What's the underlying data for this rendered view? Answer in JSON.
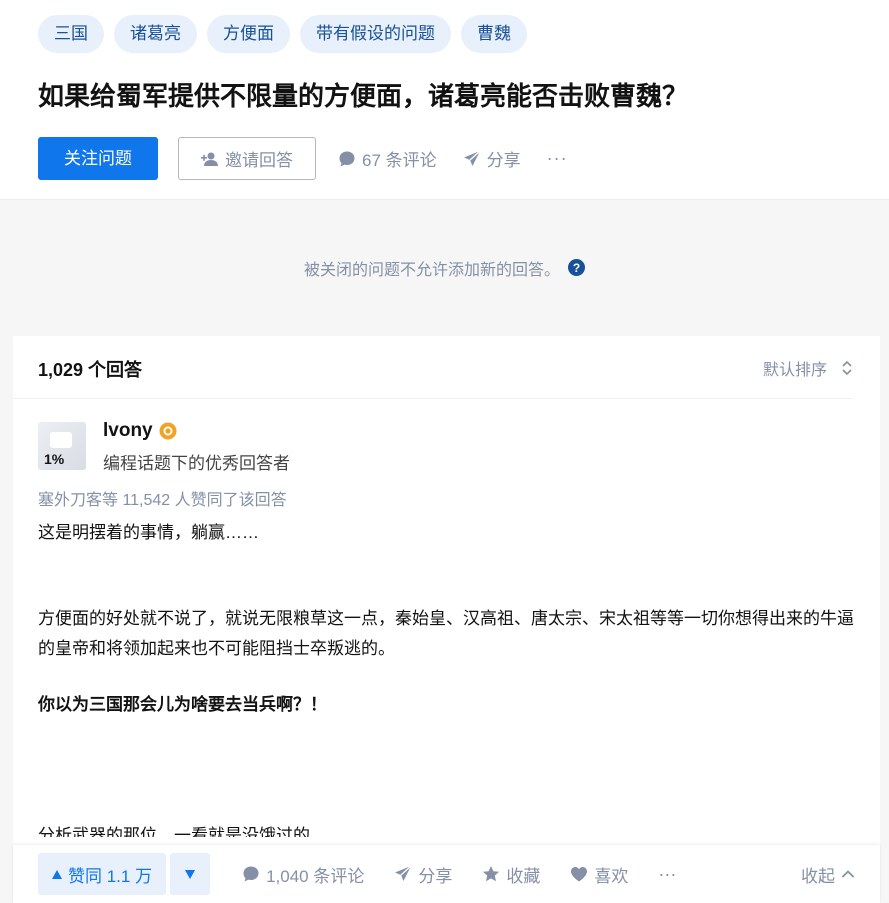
{
  "question": {
    "topics": [
      "三国",
      "诸葛亮",
      "方便面",
      "带有假设的问题",
      "曹魏"
    ],
    "title": "如果给蜀军提供不限量的方便面，诸葛亮能否击败曹魏？",
    "follow_label": "关注问题",
    "invite_label": "邀请回答",
    "comments_label": "67 条评论",
    "share_label": "分享",
    "more_label": "···"
  },
  "closed_notice": "被关闭的问题不允许添加新的回答。",
  "answers_header": {
    "count_label": "1,029 个回答",
    "sort_label": "默认排序"
  },
  "answer": {
    "avatar_text": "1%",
    "author_name": "lvony",
    "author_desc": "编程话题下的优秀回答者",
    "votes_line": "塞外刀客等 11,542 人赞同了该回答",
    "paragraphs": {
      "p1": "这是明摆着的事情，躺赢……",
      "p2": "方便面的好处就不说了，就说无限粮草这一点，秦始皇、汉高祖、唐太宗、宋太祖等等一切你想得出来的牛逼的皇帝和将领加起来也不可能阻挡士卒叛逃的。",
      "p3": "你以为三国那会儿为啥要去当兵啊？！",
      "p4": "分析武器的那位，一看就是没饿过的"
    }
  },
  "action_bar": {
    "upvote_label": "赞同 1.1 万",
    "comments_label": "1,040 条评论",
    "share_label": "分享",
    "favorite_label": "收藏",
    "like_label": "喜欢",
    "more_label": "···",
    "collapse_label": "收起"
  },
  "colors": {
    "brand_blue": "#0f76ec",
    "topic_bg": "#e8f0fb",
    "topic_text": "#175199",
    "muted_text": "#8590a6"
  },
  "icons": [
    "add-user-icon",
    "comment-icon",
    "share-icon",
    "more-icon",
    "question-mark-icon",
    "sort-icon",
    "verified-badge-icon",
    "upvote-triangle-icon",
    "downvote-triangle-icon",
    "star-icon",
    "heart-icon",
    "chevron-up-icon"
  ]
}
